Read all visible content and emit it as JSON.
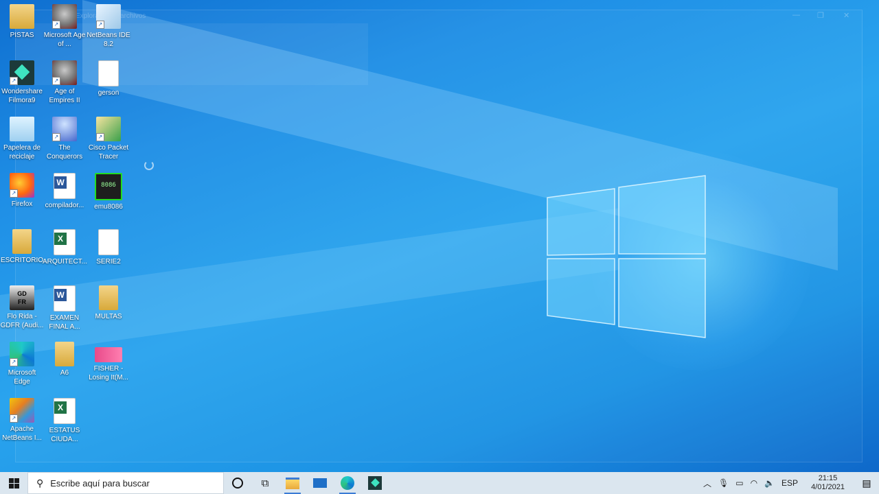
{
  "background_window": {
    "title": "Explorador de archivos",
    "controls": [
      "—",
      "❐",
      "✕"
    ]
  },
  "desktop_icons": [
    {
      "label": "PISTAS",
      "icon": "folder-icon",
      "shortcut": false
    },
    {
      "label": "Microsoft Age of ...",
      "icon": "age-of-empires-icon",
      "shortcut": true
    },
    {
      "label": "NetBeans IDE 8.2",
      "icon": "netbeans-cube-icon",
      "shortcut": true
    },
    {
      "label": "Wondershare Filmora9",
      "icon": "filmora-icon",
      "shortcut": true
    },
    {
      "label": "Age of Empires II",
      "icon": "age-of-empires-icon",
      "shortcut": true
    },
    {
      "label": "gerson",
      "icon": "text-file-icon",
      "shortcut": false
    },
    {
      "label": "Papelera de reciclaje",
      "icon": "recycle-bin-icon",
      "shortcut": false
    },
    {
      "label": "The Conquerors",
      "icon": "conquerors-icon",
      "shortcut": true
    },
    {
      "label": "Cisco Packet Tracer",
      "icon": "cisco-packet-tracer-icon",
      "shortcut": true
    },
    {
      "label": "Firefox",
      "icon": "firefox-icon",
      "shortcut": true
    },
    {
      "label": "compilador...",
      "icon": "word-doc-icon",
      "shortcut": false
    },
    {
      "label": "emu8086",
      "icon": "emu8086-chip-icon",
      "shortcut": true
    },
    {
      "label": "ESCRITORIO",
      "icon": "folder-icon",
      "shortcut": false
    },
    {
      "label": "ARQUITECT...",
      "icon": "excel-doc-icon",
      "shortcut": false
    },
    {
      "label": "SERIE2",
      "icon": "text-file-icon",
      "shortcut": false
    },
    {
      "label": "Flo Rida - GDFR (Audi...",
      "icon": "album-art-icon",
      "shortcut": false
    },
    {
      "label": "EXAMEN FINAL A...",
      "icon": "word-doc-icon",
      "shortcut": false
    },
    {
      "label": "MULTAS",
      "icon": "folder-icon",
      "shortcut": false
    },
    {
      "label": "Microsoft Edge",
      "icon": "edge-icon",
      "shortcut": true
    },
    {
      "label": "A6",
      "icon": "folder-icon",
      "shortcut": false
    },
    {
      "label": "FISHER - Losing It(M...",
      "icon": "video-thumbnail-icon",
      "shortcut": false
    },
    {
      "label": "Apache NetBeans I...",
      "icon": "apache-netbeans-icon",
      "shortcut": true
    },
    {
      "label": "ESTATUS CIUDA...",
      "icon": "excel-doc-icon",
      "shortcut": false
    }
  ],
  "emu_chip_text": "8086",
  "album_art_text": "GD\nFR",
  "taskbar": {
    "search_placeholder": "Escribe aquí para buscar",
    "pinned": [
      "cortana-icon",
      "task-view-icon",
      "file-explorer-icon",
      "mail-icon",
      "edge-icon",
      "filmora-icon"
    ],
    "tray": {
      "language": "ESP",
      "time": "21:15",
      "date": "4/01/2021"
    }
  },
  "colors": {
    "wallpaper_blue": "#1f8fe6",
    "taskbar": "#dbe6ef",
    "accent": "#3a7bd5"
  }
}
